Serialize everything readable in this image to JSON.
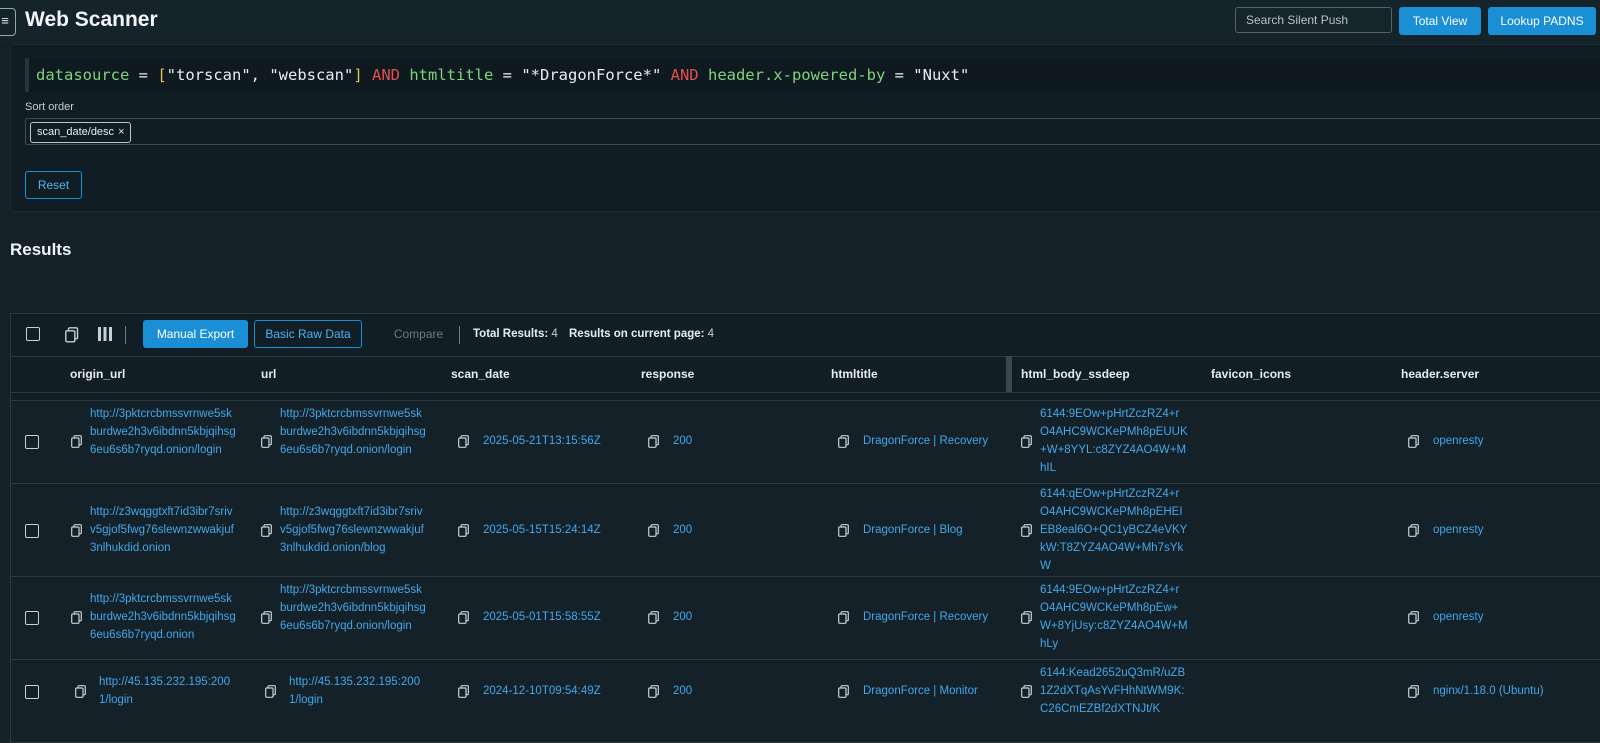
{
  "app": {
    "title": "Web Scanner",
    "menu_icon": "hamburger-icon",
    "search_placeholder": "Search Silent Push",
    "total_view_label": "Total View",
    "lookup_label": "Lookup PADNS"
  },
  "query": {
    "field1": "datasource",
    "eq1": " = ",
    "open_bracket": "[",
    "val1": "\"torscan\", \"webscan\"",
    "close_bracket": "]",
    "and1": " AND ",
    "field2": "htmltitle",
    "eq2": " = ",
    "val2": "\"*DragonForce*\"",
    "and2": " AND ",
    "field3": "header.x-powered-by",
    "eq3": " = ",
    "val3": "\"Nuxt\""
  },
  "sort": {
    "label": "Sort order",
    "chip": "scan_date/desc",
    "chip_remove": "×"
  },
  "reset_label": "Reset",
  "results": {
    "title": "Results",
    "toolbar": {
      "manual_export": "Manual Export",
      "basic_raw": "Basic Raw Data",
      "compare": "Compare",
      "total_label": "Total Results:",
      "total_value": "4",
      "page_label": "Results on current page:",
      "page_value": "4"
    },
    "columns": [
      "origin_url",
      "url",
      "scan_date",
      "response",
      "htmltitle",
      "html_body_ssdeep",
      "favicon_icons",
      "header.server"
    ],
    "rows": [
      {
        "origin_url": "http://3pktcrcbmssvrnwe5skburdwe2h3v6ibdnn5kbjqihsg6eu6s6b7ryqd.onion/login",
        "url": "http://3pktcrcbmssvrnwe5skburdwe2h3v6ibdnn5kbjqihsg6eu6s6b7ryqd.onion/login",
        "scan_date": "2025-05-21T13:15:56Z",
        "response": "200",
        "htmltitle": "DragonForce | Recovery",
        "ssdeep": "6144:9EOw+pHrtZczRZ4+rO4AHC9WCKePMh8pEUUK+W+8YYL:c8ZYZ4AO4W+MhIL",
        "server": "openresty"
      },
      {
        "origin_url": "http://z3wqggtxft7id3ibr7srivv5gjof5fwg76slewnzwwakjuf3nlhukdid.onion",
        "url": "http://z3wqggtxft7id3ibr7srivv5gjof5fwg76slewnzwwakjuf3nlhukdid.onion/blog",
        "scan_date": "2025-05-15T15:24:14Z",
        "response": "200",
        "htmltitle": "DragonForce | Blog",
        "ssdeep": "6144:qEOw+pHrtZczRZ4+rO4AHC9WCKePMh8pEHEIEB8eal6O+QC1yBCZ4eVKYkW:T8ZYZ4AO4W+Mh7sYkW",
        "server": "openresty"
      },
      {
        "origin_url": "http://3pktcrcbmssvrnwe5skburdwe2h3v6ibdnn5kbjqihsg6eu6s6b7ryqd.onion",
        "url": "http://3pktcrcbmssvrnwe5skburdwe2h3v6ibdnn5kbjqihsg6eu6s6b7ryqd.onion/login",
        "scan_date": "2025-05-01T15:58:55Z",
        "response": "200",
        "htmltitle": "DragonForce | Recovery",
        "ssdeep": "6144:9EOw+pHrtZczRZ4+rO4AHC9WCKePMh8pEw+W+8YjUsy:c8ZYZ4AO4W+MhLy",
        "server": "openresty"
      },
      {
        "origin_url": "http://45.135.232.195:2001/login",
        "url": "http://45.135.232.195:2001/login",
        "scan_date": "2024-12-10T09:54:49Z",
        "response": "200",
        "htmltitle": "DragonForce | Monitor",
        "ssdeep": "6144:Kead2652uQ3mR/uZB1Z2dXTqAsYvFHhNtWM9K:C26CmEZBf2dXTNJt/K",
        "server": "nginx/1.18.0 (Ubuntu)"
      }
    ]
  },
  "colors": {
    "background": "#142129",
    "accent": "#1a8fd6",
    "link": "#43a7ea",
    "keyword": "#e24e4e",
    "field": "#7ed37e"
  }
}
